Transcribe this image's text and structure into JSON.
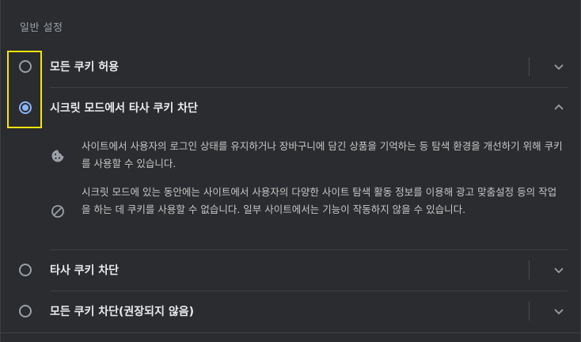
{
  "section": {
    "title": "일반 설정"
  },
  "options": [
    {
      "label": "모든 쿠키 허용",
      "selected": false,
      "expanded": false
    },
    {
      "label": "시크릿 모드에서 타사 쿠키 차단",
      "selected": true,
      "expanded": true
    },
    {
      "label": "타사 쿠키 차단",
      "selected": false,
      "expanded": false
    },
    {
      "label": "모든 쿠키 차단(권장되지 않음)",
      "selected": false,
      "expanded": false
    }
  ],
  "details": [
    {
      "icon": "cookie-icon",
      "text": "사이트에서 사용자의 로그인 상태를 유지하거나 장바구니에 담긴 상품을 기억하는 등 탐색 환경을 개선하기 위해 쿠키를 사용할 수 있습니다."
    },
    {
      "icon": "block-icon",
      "text": "시크릿 모드에 있는 동안에는 사이트에서 사용자의 다양한 사이트 탐색 활동 정보를 이용해 광고 맞춤설정 등의 작업을 하는 데 쿠키를 사용할 수 없습니다. 일부 사이트에서는 기능이 작동하지 않을 수 있습니다."
    }
  ],
  "colors": {
    "background": "#2b2c2f",
    "accent": "#8ab4f8",
    "highlight": "#f5e50a",
    "text": "#e8eaed",
    "secondary_text": "#9aa0a6"
  }
}
